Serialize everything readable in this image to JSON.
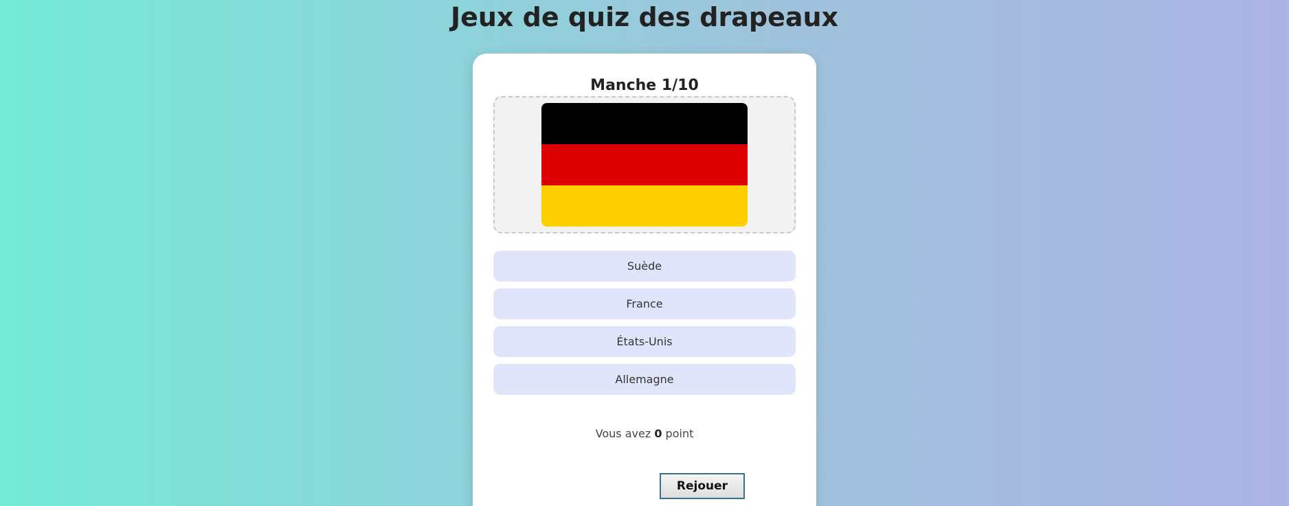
{
  "header": {
    "title": "Jeux de quiz des drapeaux"
  },
  "round": {
    "label": "Manche 1/10"
  },
  "flag": {
    "name": "germany-flag",
    "stripes": [
      "#000000",
      "#dd0000",
      "#ffce00"
    ]
  },
  "answers": [
    {
      "label": "Suède"
    },
    {
      "label": "France"
    },
    {
      "label": "États-Unis"
    },
    {
      "label": "Allemagne"
    }
  ],
  "score": {
    "prefix": "Vous avez",
    "points": "0",
    "suffix": "point"
  },
  "actions": {
    "replay_label": "Rejouer"
  }
}
